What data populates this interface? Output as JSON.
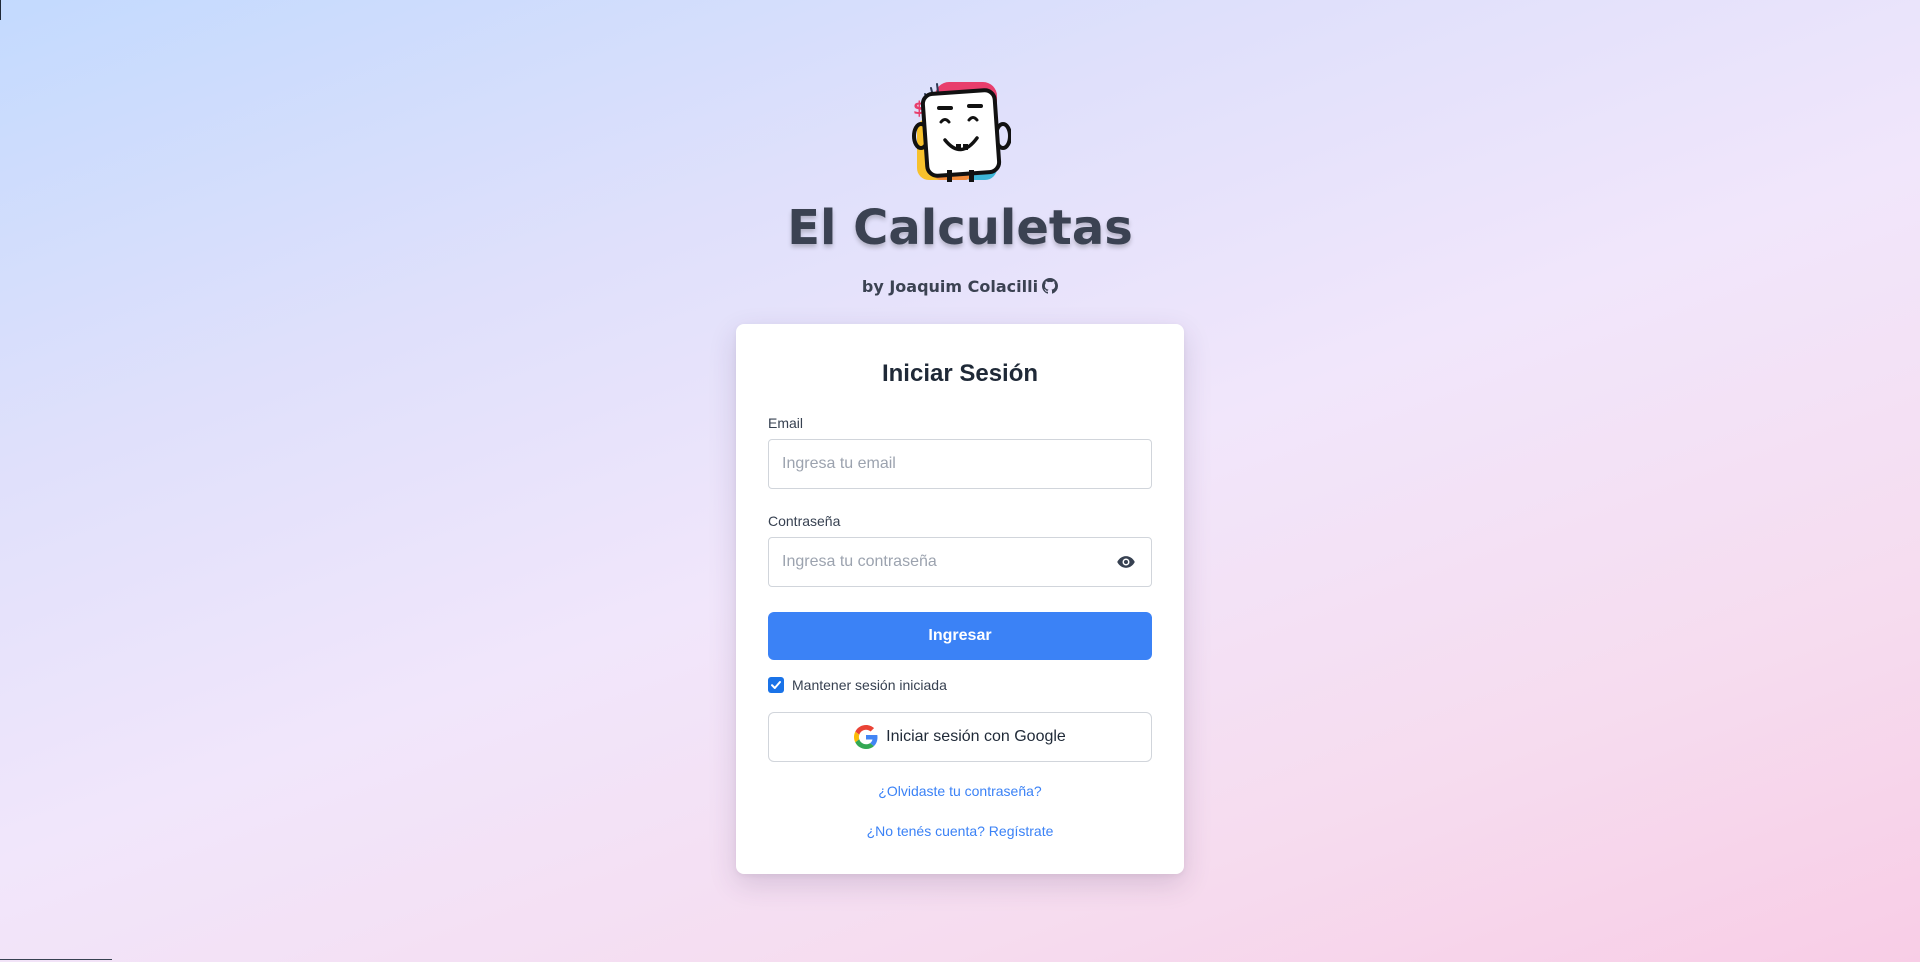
{
  "header": {
    "title": "El Calculetas",
    "byline": "by Joaquim Colacilli"
  },
  "login": {
    "title": "Iniciar Sesión",
    "email_label": "Email",
    "email_placeholder": "Ingresa tu email",
    "email_value": "",
    "password_label": "Contraseña",
    "password_placeholder": "Ingresa tu contraseña",
    "password_value": "",
    "submit_label": "Ingresar",
    "remember_label": "Mantener sesión iniciada",
    "remember_checked": true,
    "google_label": "Iniciar sesión con Google",
    "forgot_link": "¿Olvidaste tu contraseña?",
    "register_link": "¿No tenés cuenta? Regístrate"
  },
  "icons": {
    "logo": "calculator-mascot-logo",
    "byline": "github-icon",
    "password_toggle": "eye-icon",
    "google": "google-icon",
    "checkbox": "check-icon"
  },
  "colors": {
    "primary": "#3b82f6",
    "checkbox": "#1a73e8",
    "title": "#3b4252",
    "link": "#3b82f6"
  }
}
